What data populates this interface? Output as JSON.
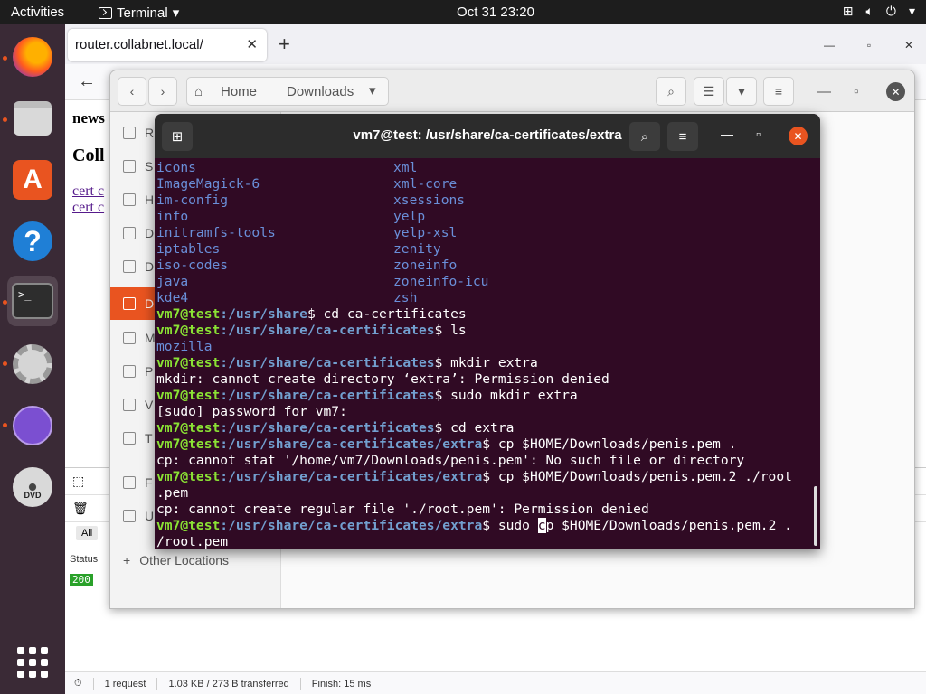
{
  "topbar": {
    "activities": "Activities",
    "app_name": "Terminal",
    "datetime": "Oct 31  23:20",
    "tray": [
      "network-icon",
      "volume-icon",
      "power-icon"
    ]
  },
  "dock": {
    "items": [
      "firefox",
      "files",
      "ubuntu-software",
      "help",
      "terminal",
      "settings",
      "web-browser",
      "dvd",
      "show-applications"
    ],
    "terminal_glyph": ">_",
    "dvd_label": "DVD"
  },
  "firefox": {
    "tab_title": "router.collabnet.local/",
    "page_heading_1": "news",
    "page_heading_2": "Coll",
    "page_links": [
      "cert c",
      "cert c"
    ],
    "devtools": {
      "filter_all": "All",
      "status_header": "Status",
      "status_value": "200",
      "footer": {
        "requests": "1 request",
        "transferred": "1.03 KB / 273 B transferred",
        "finish": "Finish: 15 ms"
      }
    }
  },
  "files": {
    "breadcrumb": [
      "Home",
      "Downloads"
    ],
    "sidebar_letters": [
      "R",
      "S",
      "H",
      "D",
      "D",
      "D",
      "M",
      "P",
      "V",
      "T",
      "F",
      "U"
    ],
    "other_locations": "Other Locations"
  },
  "terminal": {
    "title": "vm7@test: /usr/share/ca-certificates/extra",
    "ls_columns": [
      [
        "icons",
        "xml"
      ],
      [
        "ImageMagick-6",
        "xml-core"
      ],
      [
        "im-config",
        "xsessions"
      ],
      [
        "info",
        "yelp"
      ],
      [
        "initramfs-tools",
        "yelp-xsl"
      ],
      [
        "iptables",
        "zenity"
      ],
      [
        "iso-codes",
        "zoneinfo"
      ],
      [
        "java",
        "zoneinfo-icu"
      ],
      [
        "kde4",
        "zsh"
      ]
    ],
    "user_host": "vm7@test",
    "lines": [
      {
        "type": "prompt",
        "path": ":/usr/share",
        "cmd": "$ cd ca-certificates"
      },
      {
        "type": "prompt",
        "path": ":/usr/share/ca-certificates",
        "cmd": "$ ls"
      },
      {
        "type": "dir",
        "text": "mozilla"
      },
      {
        "type": "prompt",
        "path": ":/usr/share/ca-certificates",
        "cmd": "$ mkdir extra"
      },
      {
        "type": "out",
        "text": "mkdir: cannot create directory ‘extra’: Permission denied"
      },
      {
        "type": "prompt",
        "path": ":/usr/share/ca-certificates",
        "cmd": "$ sudo mkdir extra"
      },
      {
        "type": "out",
        "text": "[sudo] password for vm7:"
      },
      {
        "type": "prompt",
        "path": ":/usr/share/ca-certificates",
        "cmd": "$ cd extra"
      },
      {
        "type": "prompt",
        "path": ":/usr/share/ca-certificates/extra",
        "cmd": "$ cp $HOME/Downloads/penis.pem ."
      },
      {
        "type": "out",
        "text": "cp: cannot stat '/home/vm7/Downloads/penis.pem': No such file or directory"
      },
      {
        "type": "prompt",
        "path": ":/usr/share/ca-certificates/extra",
        "cmd": "$ cp $HOME/Downloads/penis.pem.2 ./root"
      },
      {
        "type": "out",
        "text": ".pem"
      },
      {
        "type": "out",
        "text": "cp: cannot create regular file './root.pem': Permission denied"
      }
    ],
    "current_prompt": {
      "path": ":/usr/share/ca-certificates/extra",
      "before_cursor": "$ sudo ",
      "cursor_char": "c",
      "after_cursor": "p $HOME/Downloads/penis.pem.2 .",
      "continuation": "/root.pem"
    }
  }
}
